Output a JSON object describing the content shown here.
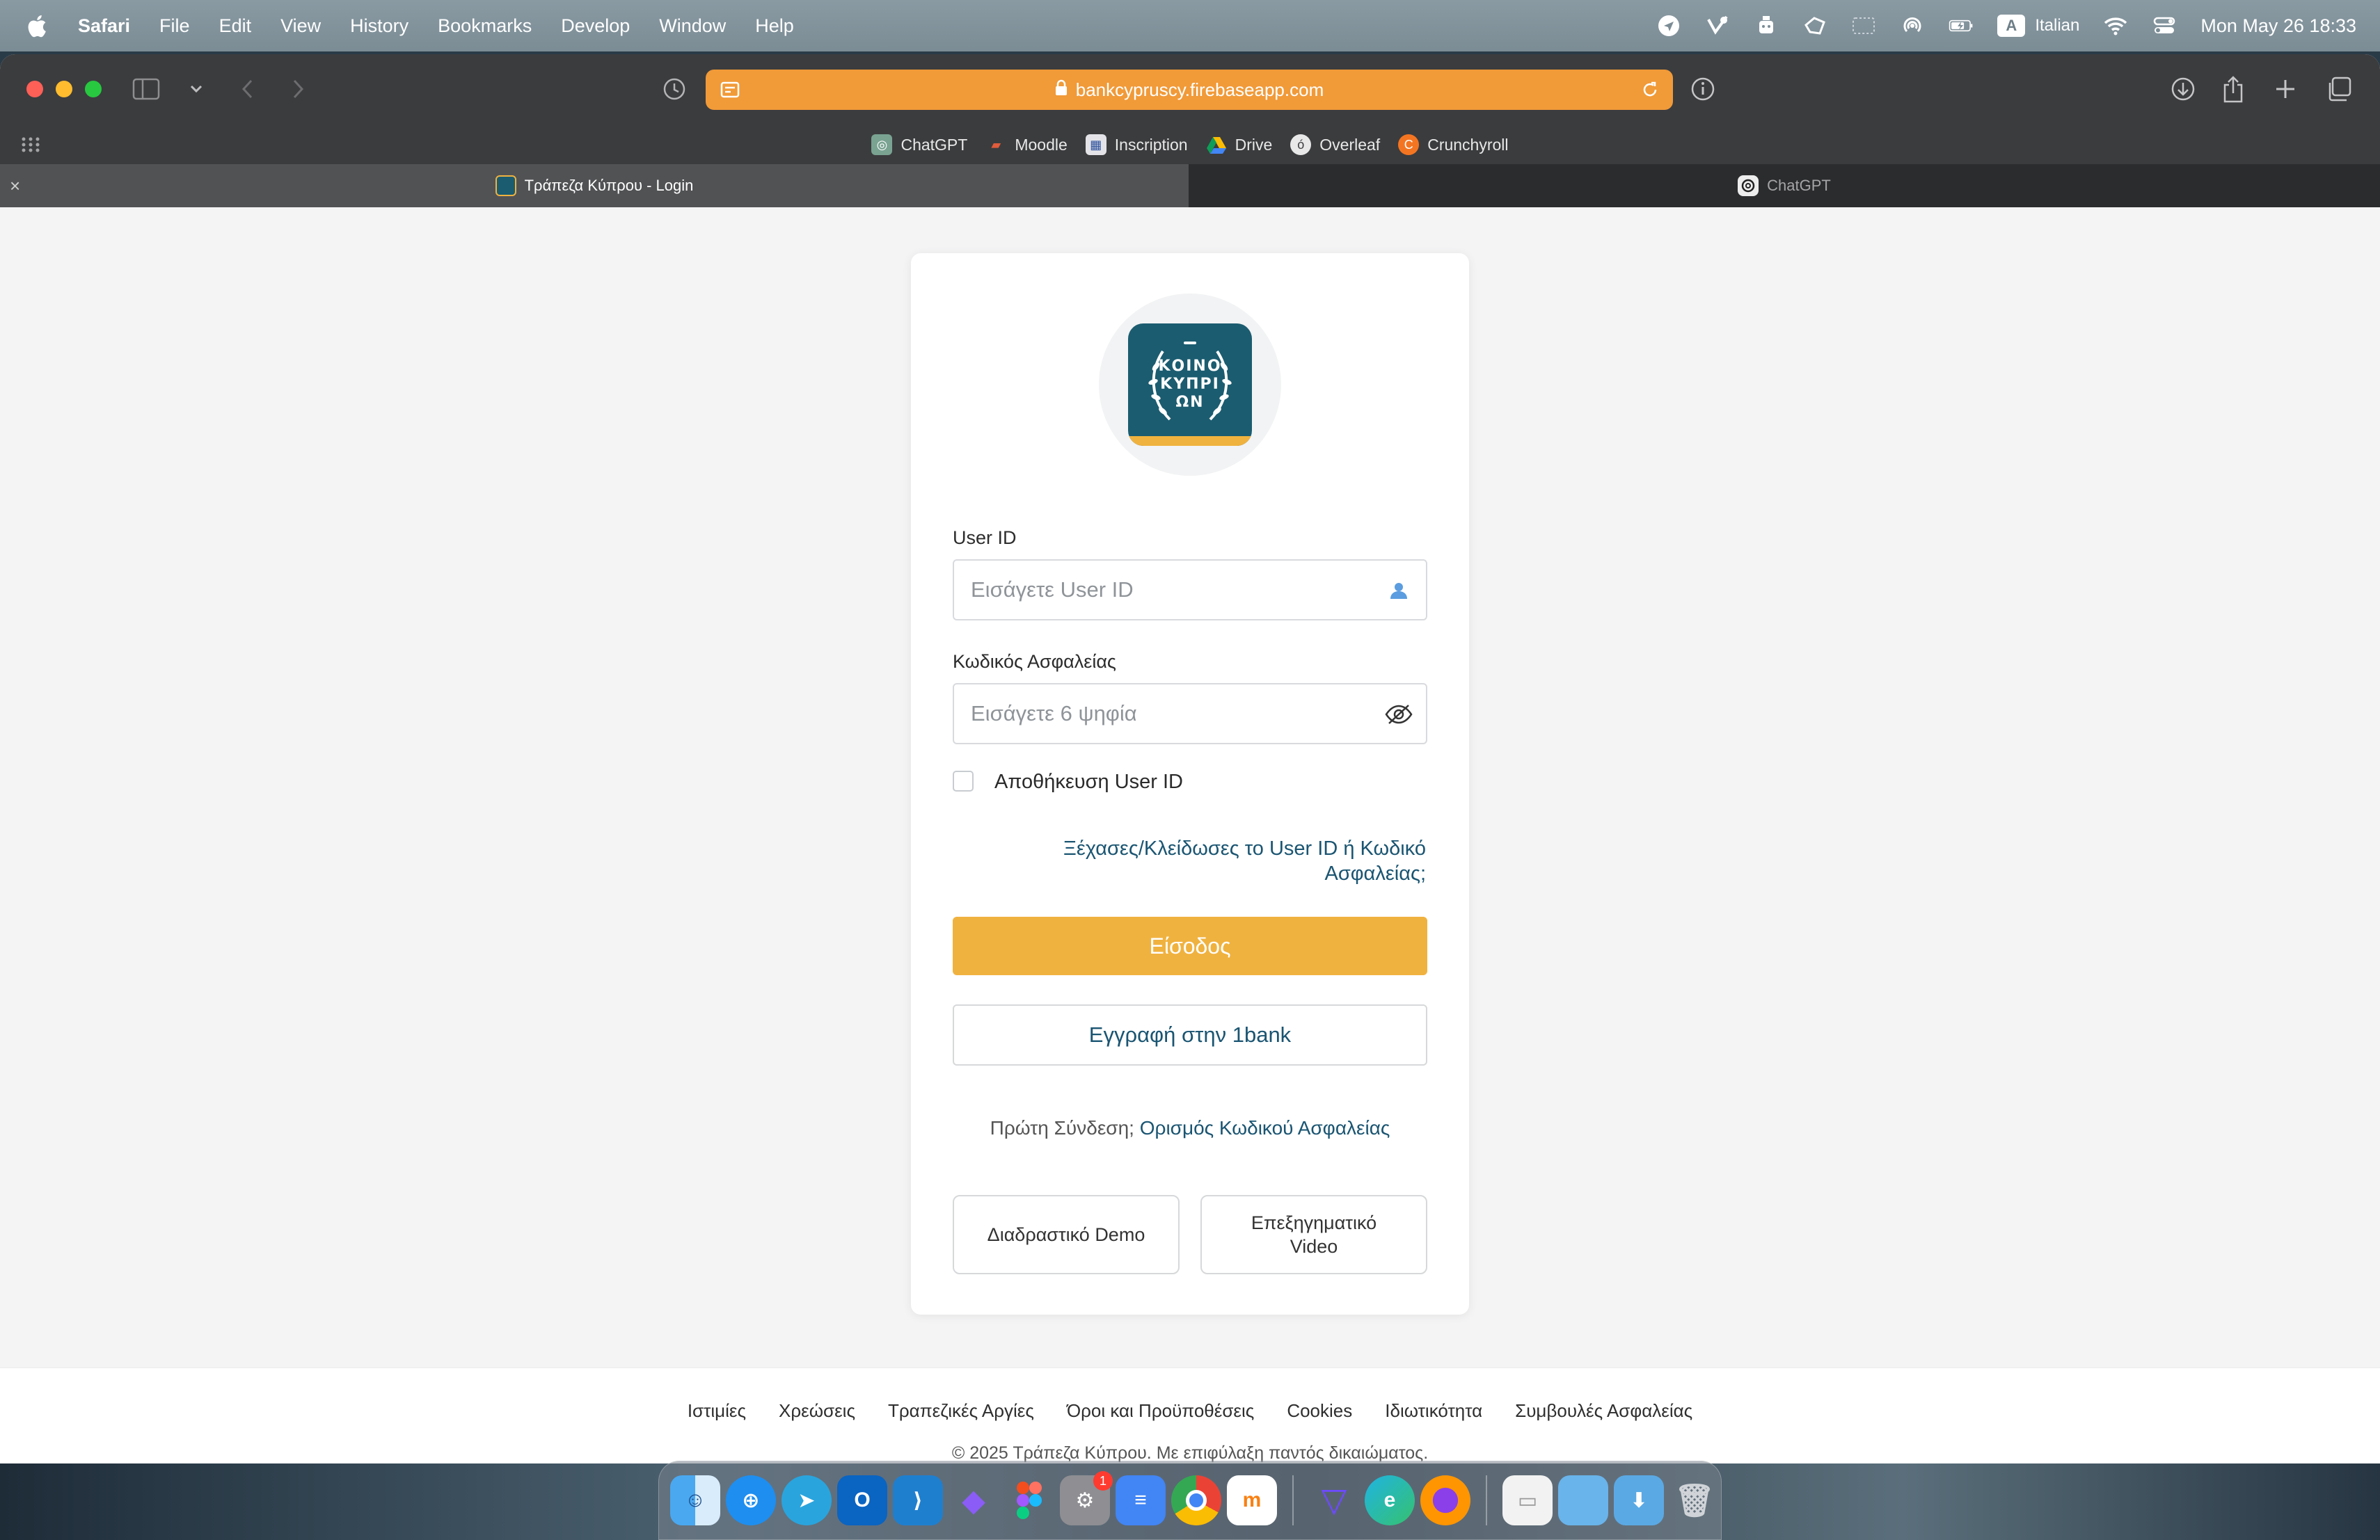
{
  "menubar": {
    "app_name": "Safari",
    "items": [
      "File",
      "Edit",
      "View",
      "History",
      "Bookmarks",
      "Develop",
      "Window",
      "Help"
    ],
    "input_source_badge": "A",
    "input_language": "Italian",
    "datetime": "Mon May 26  18:33"
  },
  "browser": {
    "url": "bankcypruscy.firebaseapp.com",
    "accent_color": "#f19a38",
    "favorites": [
      {
        "label": "ChatGPT",
        "icon": "chatgpt-icon"
      },
      {
        "label": "Moodle",
        "icon": "moodle-icon"
      },
      {
        "label": "Inscription",
        "icon": "inscription-icon"
      },
      {
        "label": "Drive",
        "icon": "drive-icon"
      },
      {
        "label": "Overleaf",
        "icon": "overleaf-icon"
      },
      {
        "label": "Crunchyroll",
        "icon": "crunchyroll-icon"
      }
    ],
    "tabs": [
      {
        "title": "Τράπεζα Κύπρου - Login",
        "active": true
      },
      {
        "title": "ChatGPT",
        "active": false
      }
    ]
  },
  "login": {
    "logo_text": [
      "ΚΟΙΝΟ",
      "ΚΥΠΡΙ",
      "ΩΝ"
    ],
    "brand_color": "#1b5c70",
    "accent_color": "#f0b23f",
    "user_id_label": "User ID",
    "user_id_placeholder": "Εισάγετε User ID",
    "password_label": "Κωδικός Ασφαλείας",
    "password_placeholder": "Εισάγετε 6 ψηφία",
    "remember_label": "Αποθήκευση User ID",
    "forgot_link": "Ξέχασες/Κλείδωσες το User ID ή Κωδικό Ασφαλείας;",
    "login_button": "Είσοδος",
    "register_button": "Εγγραφή στην 1bank",
    "first_login_text": "Πρώτη Σύνδεση;",
    "first_login_link": "Ορισμός Κωδικού Ασφαλείας",
    "demo_button": "Διαδραστικό Demo",
    "video_button": "Επεξηγηματικό Video"
  },
  "footer": {
    "links": [
      "Ιστιμίες",
      "Χρεώσεις",
      "Τραπεζικές Αργίες",
      "Όροι και Προϋποθέσεις",
      "Cookies",
      "Ιδιωτικότητα",
      "Συμβουλές Ασφαλείας"
    ],
    "copyright": "© 2025 Τράπεζα Κύπρου. Με επιφύλαξη παντός δικαιώματος."
  },
  "dock": {
    "apps": [
      "finder",
      "safari",
      "telegram",
      "outlook",
      "vscode",
      "obsidian",
      "figma",
      "system-settings",
      "docs",
      "chrome",
      "moodle",
      "proton-vpn",
      "edge",
      "firefox",
      "documents",
      "folder",
      "downloads",
      "trash"
    ],
    "system_settings_badge": "1"
  }
}
